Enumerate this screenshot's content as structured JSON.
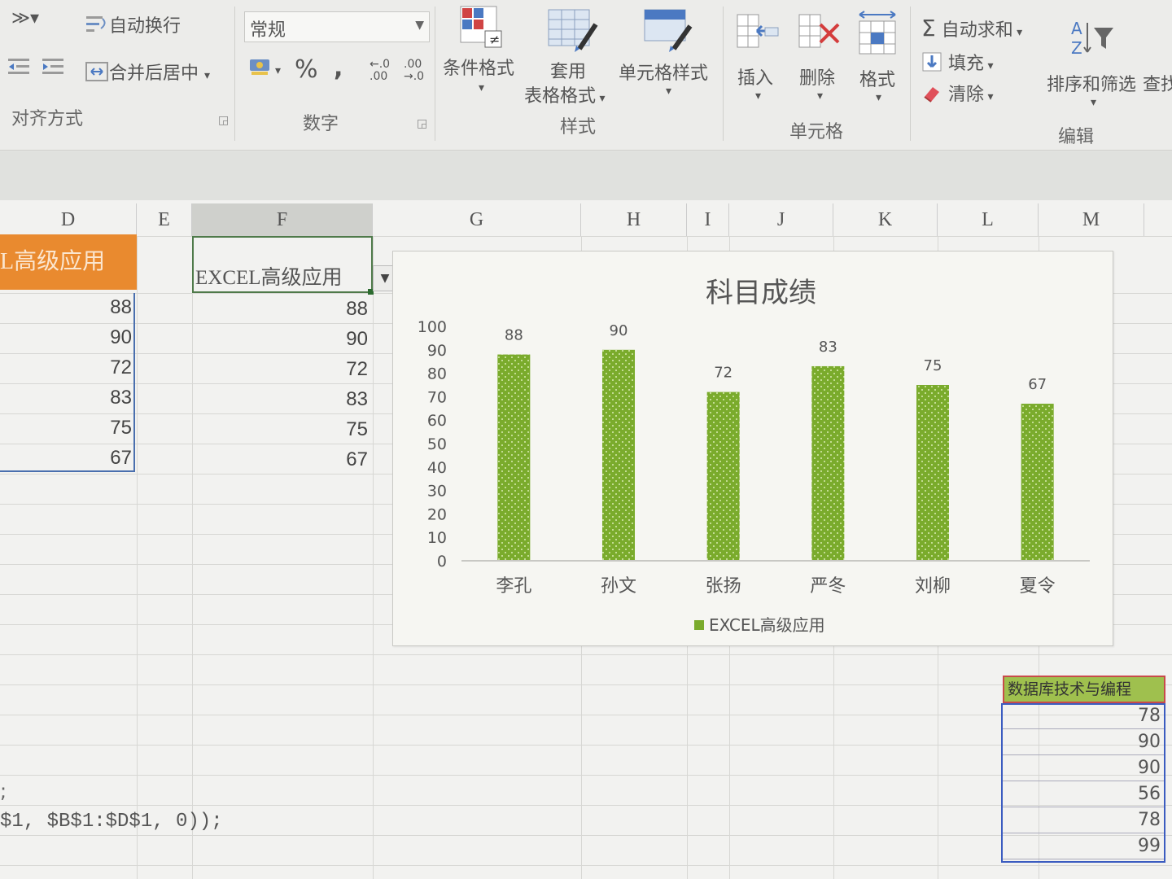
{
  "ribbon": {
    "alignment": {
      "wrap_text": "自动换行",
      "merge_center": "合并后居中",
      "group_label": "对齐方式"
    },
    "number": {
      "format_value": "常规",
      "percent": "%",
      "comma": ",",
      "inc_decimal": "←.0 .00",
      "dec_decimal": ".00 →.0",
      "group_label": "数字"
    },
    "styles": {
      "conditional_format": "条件格式",
      "table_format_line1": "套用",
      "table_format_line2": "表格格式",
      "cell_styles": "单元格样式",
      "group_label": "样式"
    },
    "cells": {
      "insert": "插入",
      "delete": "删除",
      "format": "格式",
      "group_label": "单元格"
    },
    "editing": {
      "autosum": "自动求和",
      "fill": "填充",
      "clear": "清除",
      "sort_filter": "排序和筛选",
      "find_select": "查找",
      "group_label": "编辑"
    }
  },
  "sheet": {
    "columns": [
      "D",
      "E",
      "F",
      "G",
      "H",
      "I",
      "J",
      "K",
      "L",
      "M"
    ],
    "d_header": "L高级应用",
    "f_header": "EXCEL高级应用",
    "d_values": [
      "88",
      "90",
      "72",
      "83",
      "75",
      "67"
    ],
    "f_values": [
      "88",
      "90",
      "72",
      "83",
      "75",
      "67"
    ],
    "formula_partial": "$1, $B$1:$D$1, 0));",
    "colon_text": ";",
    "db_header": "数据库技术与编程",
    "db_values": [
      "78",
      "90",
      "90",
      "56",
      "78",
      "99"
    ]
  },
  "chart_data": {
    "type": "bar",
    "title": "科目成绩",
    "categories": [
      "李孔",
      "孙文",
      "张扬",
      "严冬",
      "刘柳",
      "夏令"
    ],
    "series": [
      {
        "name": "EXCEL高级应用",
        "values": [
          88,
          90,
          72,
          83,
          75,
          67
        ]
      }
    ],
    "ylim": [
      0,
      100
    ],
    "yticks": [
      0,
      10,
      20,
      30,
      40,
      50,
      60,
      70,
      80,
      90,
      100
    ],
    "data_labels": true,
    "legend_position": "bottom",
    "colors": {
      "bar": "#7aab2c",
      "bar_dot": "#d9ecb3"
    }
  }
}
